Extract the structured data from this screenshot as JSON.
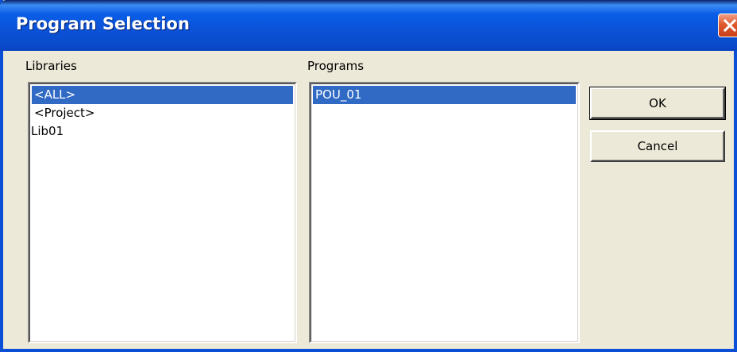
{
  "window": {
    "title": "Program Selection"
  },
  "libraries": {
    "label": "Libraries",
    "items": [
      "<ALL>",
      "<Project>",
      "Lib01"
    ],
    "selected": "<ALL>"
  },
  "programs": {
    "label": "Programs",
    "items": [
      "POU_01"
    ],
    "selected": "POU_01"
  },
  "buttons": {
    "ok_label": "OK",
    "cancel_label": "Cancel"
  },
  "colors": {
    "titlebar": "#0a5de6",
    "selection": "#316ac5",
    "dialog_bg": "#ece9d8",
    "close_button": "#e05a2c"
  },
  "icons": {
    "close": "close-icon"
  }
}
